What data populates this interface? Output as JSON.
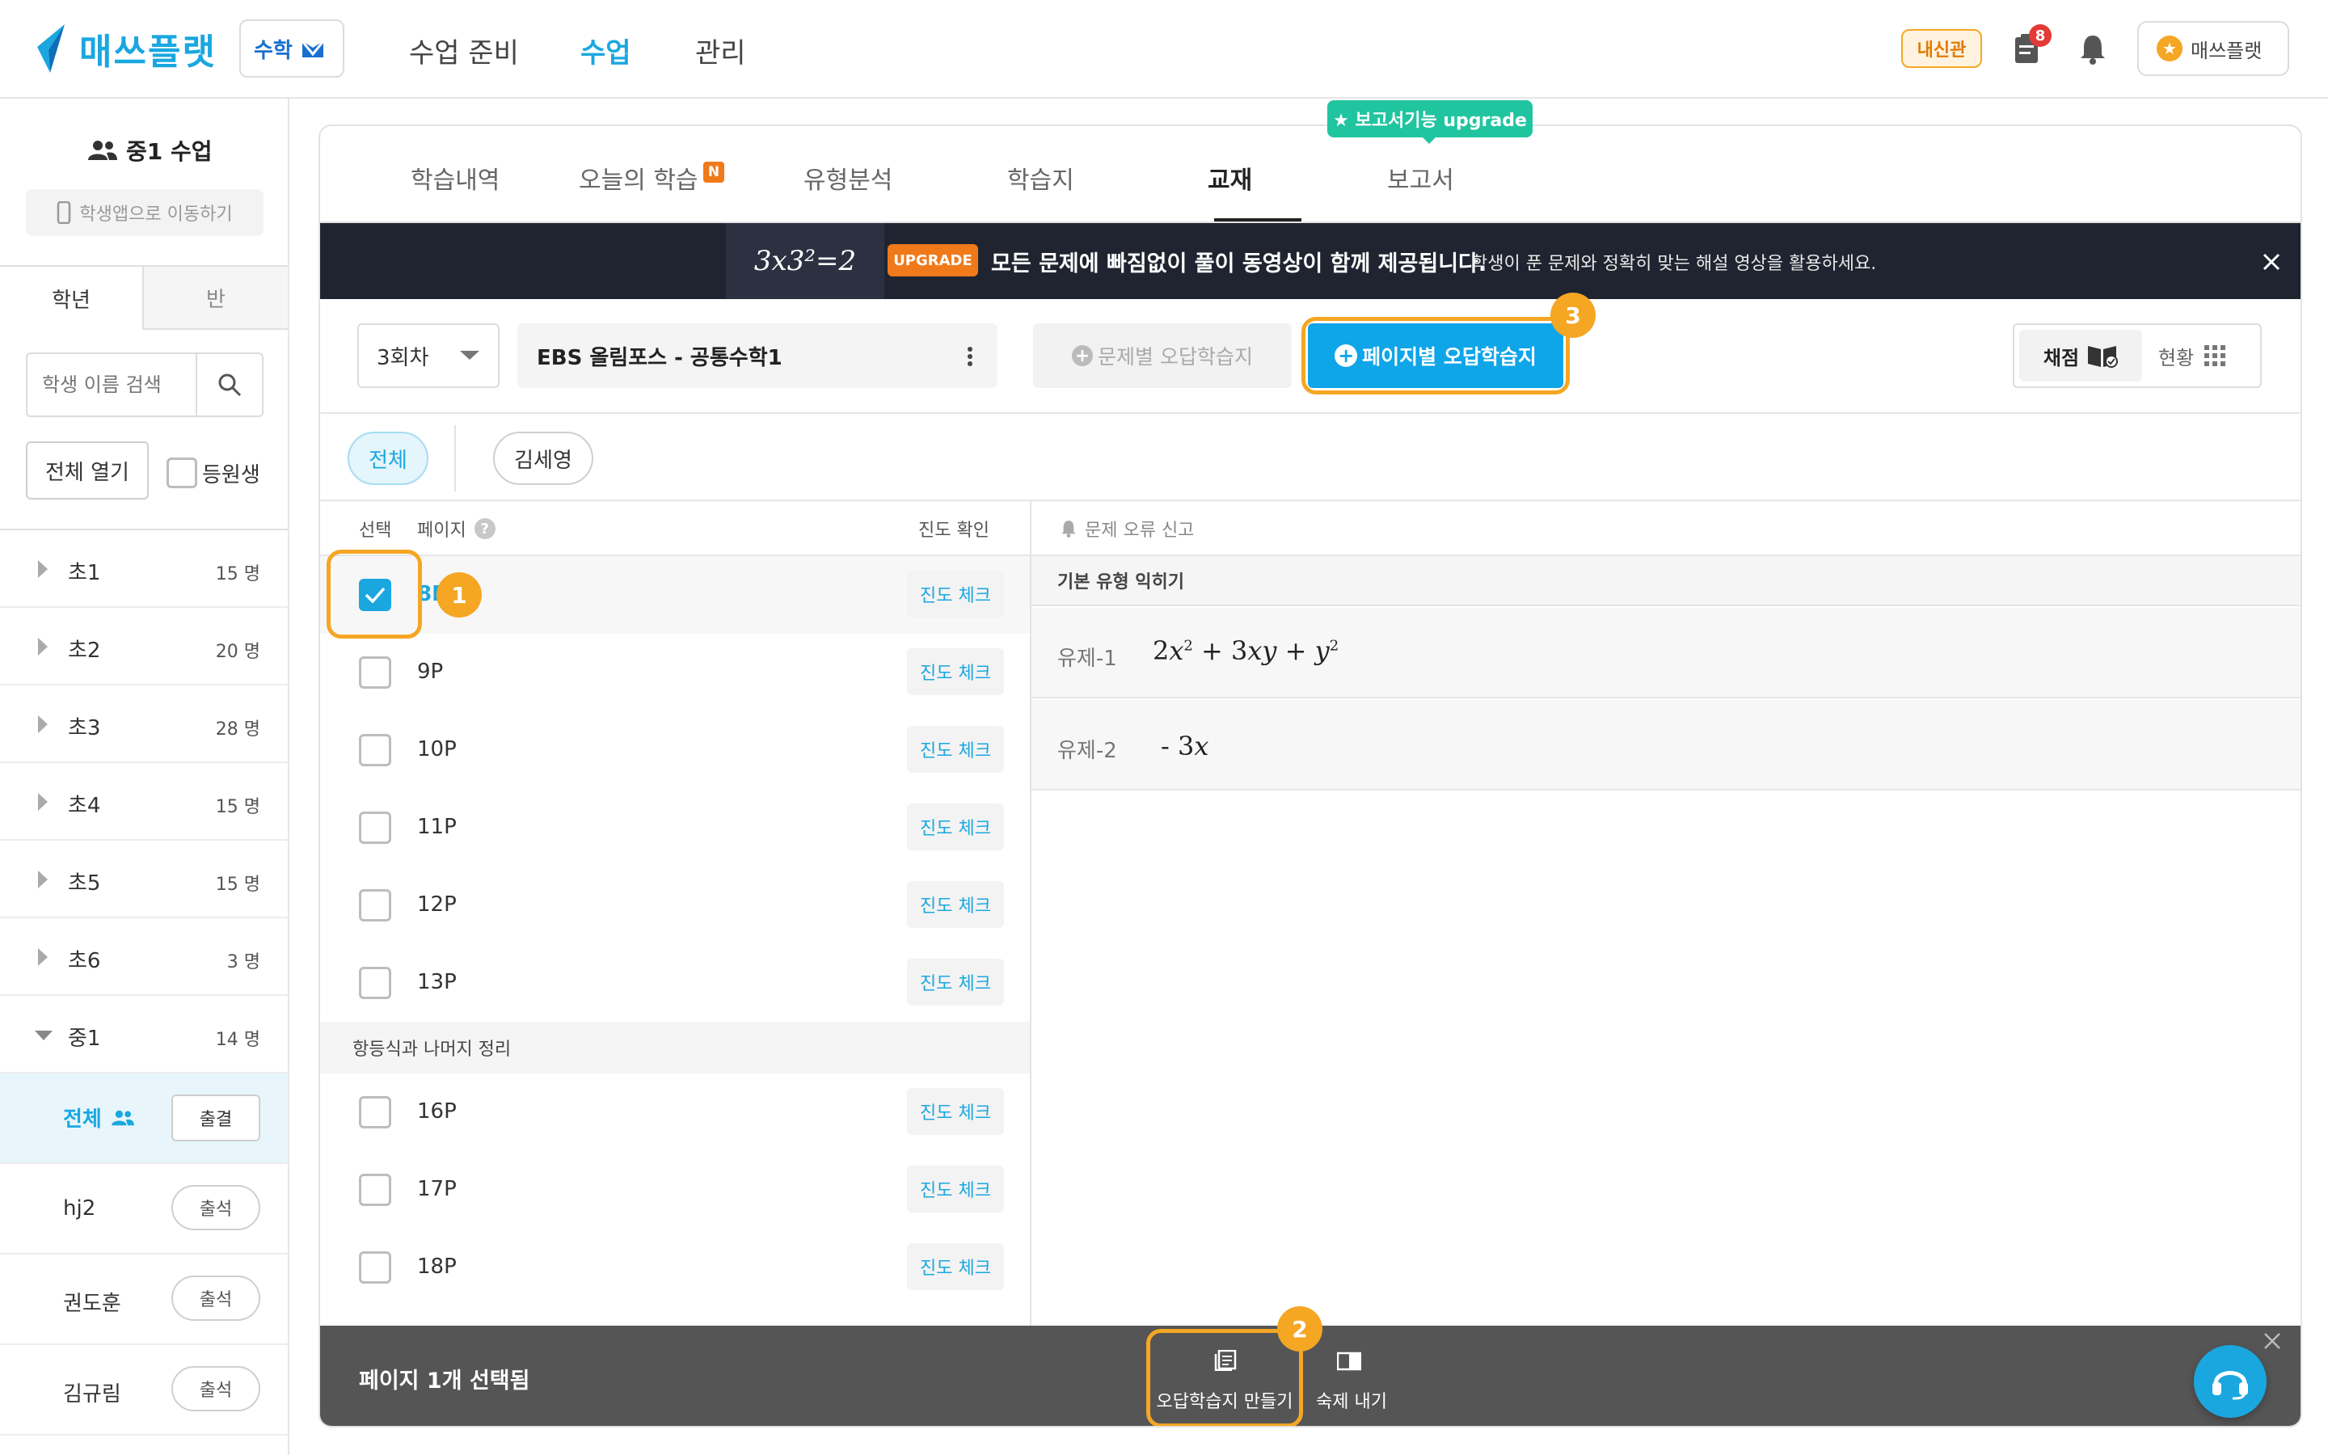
{
  "header": {
    "logo_text": "매쓰플랫",
    "subject_label": "수학",
    "nav": [
      "수업 준비",
      "수업",
      "관리"
    ],
    "naesin_badge": "내신관",
    "notification_count": "8",
    "profile_label": "매쓰플랫"
  },
  "sidebar": {
    "class_title": "중1 수업",
    "student_app_link": "학생앱으로 이동하기",
    "tabs": [
      "학년",
      "반"
    ],
    "search_placeholder": "학생 이름 검색",
    "open_all_label": "전체 열기",
    "enrolled_label": "등원생",
    "grades": [
      {
        "name": "초1",
        "count": "15 명"
      },
      {
        "name": "초2",
        "count": "20 명"
      },
      {
        "name": "초3",
        "count": "28 명"
      },
      {
        "name": "초4",
        "count": "15 명"
      },
      {
        "name": "초5",
        "count": "15 명"
      },
      {
        "name": "초6",
        "count": "3 명"
      },
      {
        "name": "중1",
        "count": "14 명"
      }
    ],
    "all_label": "전체",
    "attendance_label": "출결",
    "students": [
      {
        "name": "hj2",
        "action": "출석"
      },
      {
        "name": "권도훈",
        "action": "출석"
      },
      {
        "name": "김규림",
        "action": "출석"
      }
    ]
  },
  "tabs": {
    "items": [
      "학습내역",
      "오늘의 학습",
      "유형분석",
      "학습지",
      "교재",
      "보고서"
    ],
    "new_badge": "N",
    "active": "교재",
    "report_tooltip": "★ 보고서기능 upgrade"
  },
  "banner": {
    "upgrade_badge": "UPGRADE",
    "headline": "모든 문제에 빠짐없이 풀이 동영상이 함께 제공됩니다.",
    "subtext": "학생이 푼 문제와 정확히 맞는 해설 영상을 활용하세요.",
    "image_text": "3x3²=2"
  },
  "toolbar": {
    "round_select": "3회차",
    "book_title": "EBS 올림포스 - 공통수학1",
    "by_problem_button": "문제별 오답학습지",
    "by_page_button": "페이지별 오답학습지",
    "grade_label": "채점",
    "status_label": "현황"
  },
  "filters": {
    "all": "전체",
    "student": "김세영"
  },
  "list": {
    "col_select": "선택",
    "col_page": "페이지",
    "col_progress": "진도 확인",
    "progress_btn": "진도 체크",
    "rows": [
      {
        "page": "8P",
        "checked": true
      },
      {
        "page": "9P",
        "checked": false
      },
      {
        "page": "10P",
        "checked": false
      },
      {
        "page": "11P",
        "checked": false
      },
      {
        "page": "12P",
        "checked": false
      },
      {
        "page": "13P",
        "checked": false
      }
    ],
    "section2_title": "항등식과 나머지 정리",
    "rows2": [
      {
        "page": "16P",
        "checked": false
      },
      {
        "page": "17P",
        "checked": false
      },
      {
        "page": "18P",
        "checked": false
      }
    ]
  },
  "detail": {
    "report_error": "문제 오류 신고",
    "section_title": "기본 유형 익히기",
    "problems": [
      {
        "label": "유제-1"
      },
      {
        "label": "유제-2"
      }
    ]
  },
  "bottom_bar": {
    "selected_text": "페이지 1개 선택됨",
    "make_wrong_sheet": "오답학습지 만들기",
    "homework": "숙제 내기"
  },
  "badges": [
    "1",
    "2",
    "3"
  ],
  "colors": {
    "brand": "#1aa7e0",
    "highlight": "#f5a623",
    "banner_bg": "#1f2430",
    "bottom_bar_bg": "#555555"
  }
}
